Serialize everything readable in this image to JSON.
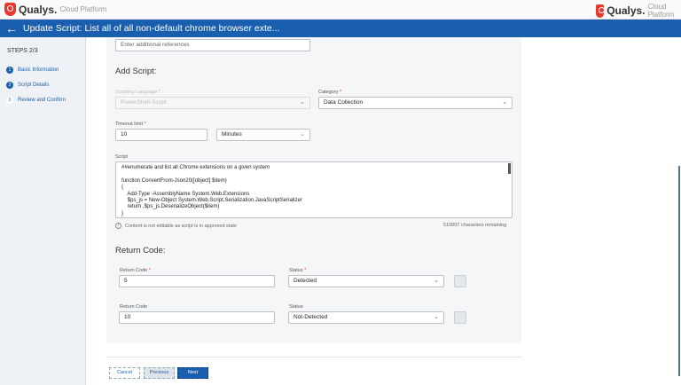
{
  "header": {
    "brand": "Qualys.",
    "platform": "Cloud Platform"
  },
  "titlebar": {
    "title": "Update Script: List all of all non-default chrome browser exte..."
  },
  "sidebar": {
    "steps_label": "STEPS 2/3",
    "steps": [
      {
        "num": "1",
        "label": "Basic Information"
      },
      {
        "num": "2",
        "label": "Script Details"
      },
      {
        "num": "3",
        "label": "Review and Confirm"
      }
    ]
  },
  "form": {
    "references_placeholder": "Enter additional references",
    "add_script_heading": "Add Script:",
    "scripting_language_label": "Scripting Language *",
    "scripting_language_value": "PowerShell-Script",
    "category_label": "Category",
    "category_value": "Data Collection",
    "timeout_label": "Timeout limit",
    "timeout_value": "10",
    "timeout_unit": "Minutes",
    "script_label": "Script",
    "script_content": "##enumerate and list all Chrome extensions on a given system\n\nfunction ConvertFrom-Json20([object] $item)\n{\n    Add-Type -AssemblyName System.Web.Extensions\n    $ps_js = New-Object System.Web.Script.Serialization.JavaScriptSerializer\n    return ,$ps_js.DeserializeObject($item)\n}",
    "not_editable_note": "Content is not editable as script is in approved state",
    "chars_remaining": "510807 characters remaining",
    "return_code_heading": "Return Code:",
    "rows": [
      {
        "code_label": "Return Code",
        "code": "5",
        "status_label": "Status",
        "status": "Detected",
        "required": true
      },
      {
        "code_label": "Return Code",
        "code": "10",
        "status_label": "Status",
        "status": "Not-Detected",
        "required": false
      }
    ],
    "required_mark": "*"
  },
  "footer": {
    "cancel": "Cancel",
    "previous": "Previous",
    "next": "Next"
  },
  "colors": {
    "primary": "#1a5fae",
    "brand_red": "#e8382e"
  }
}
